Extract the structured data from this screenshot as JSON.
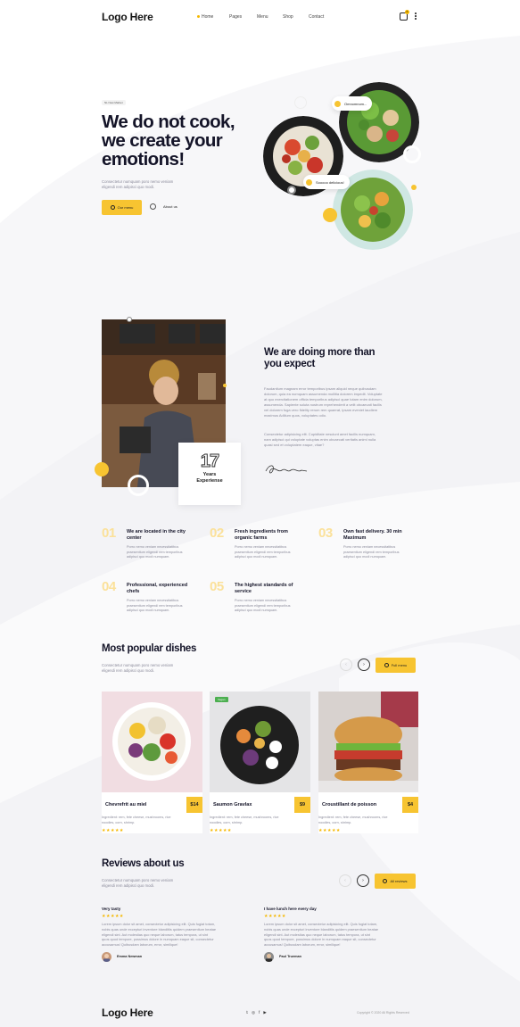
{
  "brand": {
    "logo": "Logo Here",
    "accent": "#f7c431"
  },
  "nav": {
    "items": [
      {
        "label": "Home"
      },
      {
        "label": "Pages"
      },
      {
        "label": "Menu"
      },
      {
        "label": "Shop"
      },
      {
        "label": "Contact"
      }
    ],
    "cart_count": "0"
  },
  "hero": {
    "tag": "NL New Market",
    "title_line1": "We do not cook,",
    "title_line2": "we create your",
    "title_line3": "emotions!",
    "text_line1": "Consectetur numquam poro nemo veniam",
    "text_line2": "eligendi rem adipisci quo modi.",
    "btn_menu": "Our menu",
    "btn_about": "About us",
    "bubble1": "Omnomnom...",
    "bubble2": "Sooooo delicious!"
  },
  "about": {
    "title_line1": "We are doing more than",
    "title_line2": "you expect",
    "para1": [
      "Faudantium magnam error temporibus ipsam aliquid neque quibusdam",
      "dolorum, quia ea numquam assumenda mollitia dolorem impedit. Voluptate",
      "at quo exercitationem officia temporibus adipisci quae totam enim dolorum,",
      "assumenda. Sapiente soluta nostrum reprehenderit a velit obcaecati facilis",
      "vel dolorem fuga vero fidelity rerum rem quaerat, ipsam eveniet laudiem",
      "maximus Adilium quos, voluptates odio."
    ],
    "para2": [
      "Consectetur adipisicing elit. Cupiditate nesciunt amet facilis numquam,",
      "nam adipisci qui voluptate voluptas enim obcaecati veritatis animi nulla",
      "quasi sed et voluptatem eaque, vitae?"
    ],
    "exp_number": "17",
    "exp_label_line1": "Years",
    "exp_label_line2": "Experiense",
    "signature": "Signature"
  },
  "features": [
    {
      "num": "01",
      "title_line1": "We are located in the city",
      "title_line2": "center",
      "text": [
        "Porro nemo veniam necessitatibus",
        "praesentium eligendi rem temporibus",
        "adipisci quo modi numquam."
      ]
    },
    {
      "num": "02",
      "title_line1": "Fresh ingredients from",
      "title_line2": "organic farms",
      "text": [
        "Porro nemo veniam necessitatibus",
        "praesentium eligendi rem temporibus",
        "adipisci quo modi numquam."
      ]
    },
    {
      "num": "03",
      "title_line1": "Own fast delivery. 30 min",
      "title_line2": "Maximum",
      "text": [
        "Porro nemo veniam necessitatibus",
        "praesentium eligendi rem temporibus",
        "adipisci quo modi numquam."
      ]
    },
    {
      "num": "04",
      "title_line1": "Professional, experienced",
      "title_line2": "chefs",
      "text": [
        "Porro nemo veniam necessitatibus",
        "praesentium eligendi rem temporibus",
        "adipisci quo modi numquam."
      ]
    },
    {
      "num": "05",
      "title_line1": "The highest standards of",
      "title_line2": "service",
      "text": [
        "Porro nemo veniam necessitatibus",
        "praesentium eligendi rem temporibus",
        "adipisci quo modi numquam."
      ]
    }
  ],
  "dishes": {
    "title": "Most popular dishes",
    "text_line1": "Consectetur numquam poro nemo veniam",
    "text_line2": "eligendi rem adipisci quo modi.",
    "btn_full": "Full menu",
    "items": [
      {
        "name": "Chevrefrit au miel",
        "price": "$14",
        "rating": 5,
        "desc": [
          "Ingredient: rem, fete cheese, mushrooms, rice",
          "noodles, corn, shrimp."
        ],
        "tag": ""
      },
      {
        "name": "Saumon Gravlax",
        "price": "$9",
        "rating": 5,
        "desc": [
          "Ingredient: rem, fete cheese, mushrooms, rice",
          "noodles, corn, shrimp."
        ],
        "tag": "Vegan"
      },
      {
        "name": "Croustillant de poisson",
        "price": "$4",
        "rating": 5,
        "desc": [
          "Ingredient: rem, fete cheese, mushrooms, rice",
          "noodles, corn, shrimp."
        ],
        "tag": ""
      }
    ]
  },
  "reviews": {
    "title": "Reviews about us",
    "text_line1": "Consectetur numquam poro nemo veniam",
    "text_line2": "eligendi rem adipisci quo modi.",
    "btn_all": "All reviews",
    "items": [
      {
        "title": "Very tasty",
        "rating": 5,
        "text": [
          "Lorem ipsum dolor sit amet, consectetur adipisicing elit. Quis fugiat totam,",
          "nobis quas unde excepturi inventore blanditiis quidem praesentium beatae",
          "eligendi sint. Aut molestias quo neque laborum, tatus tempora, ut sint",
          "quos quod tempore, possimus dolore in numquam eaque sit, consectetur",
          "accusamus! Quibusdam laborum, error, similique!"
        ],
        "author": "Emma Newman"
      },
      {
        "title": "I have lunch here every day",
        "rating": 5,
        "text": [
          "Lorem ipsum dolor sit amet, consectetur adipisicing elit. Quis fugiat totam,",
          "nobis quas unde excepturi inventore blanditiis quidem praesentium beatae",
          "eligendi sint. Aut molestias quo neque laborum, tatus tempora, ut sint",
          "quos quod tempore, possimus dolore in numquam eaque sit, consectetur",
          "accusamus! Quibusdam laborum, error, similique!"
        ],
        "author": "Paul Trueman"
      }
    ]
  },
  "footer": {
    "logo": "Logo Here",
    "social_icons": [
      "twitter-icon",
      "instagram-icon",
      "facebook-icon",
      "youtube-icon"
    ],
    "copyright": "Copyright © 2020 All Rights Reserved"
  }
}
